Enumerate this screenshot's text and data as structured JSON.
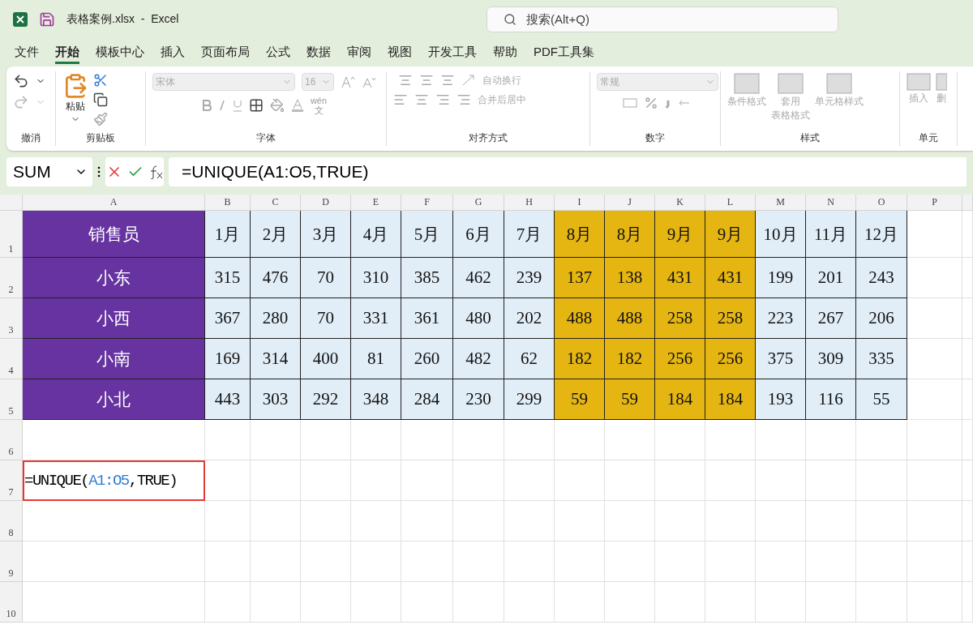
{
  "title_bar": {
    "filename": "表格案例.xlsx",
    "separator": "-",
    "app": "Excel",
    "search_placeholder": "搜索(Alt+Q)"
  },
  "menu": [
    {
      "label": "文件",
      "selected": false
    },
    {
      "label": "开始",
      "selected": true
    },
    {
      "label": "模板中心",
      "selected": false
    },
    {
      "label": "插入",
      "selected": false
    },
    {
      "label": "页面布局",
      "selected": false
    },
    {
      "label": "公式",
      "selected": false
    },
    {
      "label": "数据",
      "selected": false
    },
    {
      "label": "审阅",
      "selected": false
    },
    {
      "label": "视图",
      "selected": false
    },
    {
      "label": "开发工具",
      "selected": false
    },
    {
      "label": "帮助",
      "selected": false
    },
    {
      "label": "PDF工具集",
      "selected": false
    }
  ],
  "ribbon": {
    "undo_label": "撤消",
    "paste_label": "粘贴",
    "clipboard_label": "剪贴板",
    "font_name": "宋体",
    "font_size": "16",
    "phonetic_top": "wén",
    "phonetic_bottom": "文",
    "font_label": "字体",
    "wrap_text": "自动换行",
    "merge_center": "合并后居中",
    "align_label": "对齐方式",
    "number_format": "常规",
    "number_label": "数字",
    "styles": [
      [
        "条件格式"
      ],
      [
        "套用",
        "表格格式"
      ],
      [
        "单元格样式"
      ]
    ],
    "styles_label": "样式",
    "insert": "插入",
    "delete": "删",
    "cells_label": "单元"
  },
  "formula_bar": {
    "name_box": "SUM",
    "formula": "=UNIQUE(A1:O5,TRUE)"
  },
  "sheet": {
    "columns": [
      {
        "label": "A",
        "color": "#6633a0"
      },
      {
        "label": "B",
        "color": "#e1edf7"
      },
      {
        "label": "C",
        "color": "#e1edf7"
      },
      {
        "label": "D",
        "color": "#e1edf7"
      },
      {
        "label": "E",
        "color": "#e1edf7"
      },
      {
        "label": "F",
        "color": "#e1edf7"
      },
      {
        "label": "G",
        "color": "#e1edf7"
      },
      {
        "label": "H",
        "color": "#e1edf7"
      },
      {
        "label": "I",
        "color": "#e5b512"
      },
      {
        "label": "J",
        "color": "#e5b512"
      },
      {
        "label": "K",
        "color": "#e5b512"
      },
      {
        "label": "L",
        "color": "#e5b512"
      },
      {
        "label": "M",
        "color": "#e1edf7"
      },
      {
        "label": "N",
        "color": "#e1edf7"
      },
      {
        "label": "O",
        "color": "#e1edf7"
      },
      {
        "label": "P"
      }
    ],
    "rows": [
      {
        "label": "1",
        "cells": [
          "销售员",
          "1月",
          "2月",
          "3月",
          "4月",
          "5月",
          "6月",
          "7月",
          "8月",
          "8月",
          "9月",
          "9月",
          "10月",
          "11月",
          "12月"
        ]
      },
      {
        "label": "2",
        "cells": [
          "小东",
          "315",
          "476",
          "70",
          "310",
          "385",
          "462",
          "239",
          "137",
          "138",
          "431",
          "431",
          "199",
          "201",
          "243"
        ]
      },
      {
        "label": "3",
        "cells": [
          "小西",
          "367",
          "280",
          "70",
          "331",
          "361",
          "480",
          "202",
          "488",
          "488",
          "258",
          "258",
          "223",
          "267",
          "206"
        ]
      },
      {
        "label": "4",
        "cells": [
          "小南",
          "169",
          "314",
          "400",
          "81",
          "260",
          "482",
          "62",
          "182",
          "182",
          "256",
          "256",
          "375",
          "309",
          "335"
        ]
      },
      {
        "label": "5",
        "cells": [
          "小北",
          "443",
          "303",
          "292",
          "348",
          "284",
          "230",
          "299",
          "59",
          "59",
          "184",
          "184",
          "193",
          "116",
          "55"
        ]
      },
      {
        "label": "6"
      },
      {
        "label": "7",
        "formula": {
          "head": "=UNIQUE(",
          "ref": "A1:O5",
          "tail": ",TRUE)",
          "selected": true
        }
      },
      {
        "label": "8"
      },
      {
        "label": "9"
      },
      {
        "label": "10"
      }
    ]
  }
}
